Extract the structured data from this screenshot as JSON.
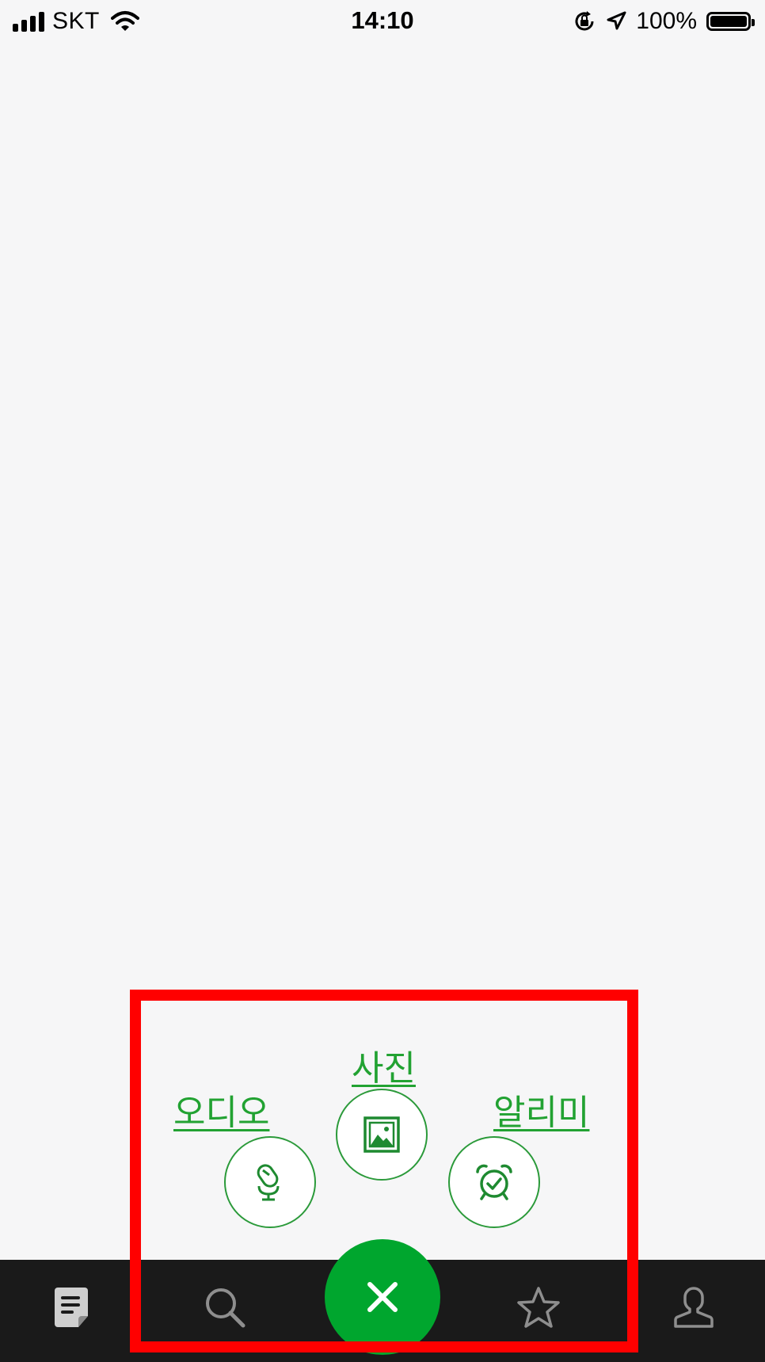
{
  "status_bar": {
    "carrier": "SKT",
    "time": "14:10",
    "battery": "100%"
  },
  "menu": {
    "audio_label": "오디오",
    "photo_label": "사진",
    "alarm_label": "알리미"
  },
  "colors": {
    "accent": "#00a62e",
    "label_green": "#22a232",
    "highlight": "#ff0000",
    "tabbar": "#1a1a1a"
  },
  "icons": {
    "tab_notes": "notes-icon",
    "tab_search": "search-icon",
    "tab_favorites": "star-icon",
    "tab_profile": "profile-icon",
    "fab_close": "close-icon",
    "audio": "microphone-icon",
    "photo": "image-icon",
    "alarm": "alarm-clock-icon"
  }
}
